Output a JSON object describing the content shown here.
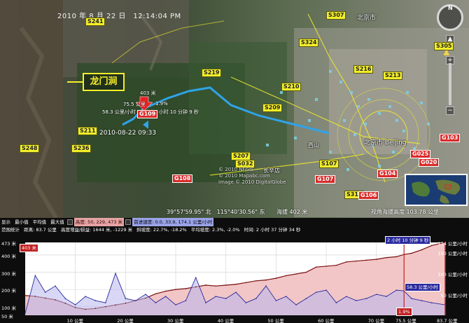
{
  "map": {
    "timestamp": "2010 年 8 月 22 日　12:14:04 PM",
    "place_label": "龙门涧",
    "start_datetime": "2010-08-22 09:33",
    "marker_elevation": "403 米",
    "marker_distance": "75.5 公里",
    "marker_speed": "58.3 公里/小时",
    "marker_grade": "1.9%",
    "marker_time": "2 小时 10 分钟 9 秒",
    "coordinates": "39°57'59.95\" 北　115°40'30.56\" 东",
    "altitude": "海拔 402 米",
    "eye_altitude": "视角海拔高度 103.78 公里",
    "copyright_lines": [
      "© 2010 NFGIS",
      "© 2010 Mapabc.com",
      "Image © 2010 DigitalGlobe"
    ],
    "cities": [
      {
        "name": "北京市"
      },
      {
        "name": "北京市 Beijing"
      },
      {
        "name": "长辛店"
      },
      {
        "name": "西山"
      }
    ],
    "road_shields": [
      "S307",
      "S241",
      "S324",
      "S305",
      "S216",
      "S219",
      "S210",
      "S213",
      "S209",
      "S211",
      "S248",
      "S236",
      "S207",
      "S032",
      "S315",
      "S107"
    ],
    "national_routes": [
      "G109",
      "G108",
      "G107",
      "G104",
      "G106",
      "G025",
      "G020",
      "G103"
    ],
    "compass_label": "N"
  },
  "panel": {
    "row1": {
      "label": "显示",
      "min_label": "最小值",
      "avg_label": "平均值",
      "max_label": "最大值",
      "elevation": "高度: 50, 229, 473 米",
      "speed": "前进速度: 0.0, 33.9, 174.1 公里/小时"
    },
    "row2": {
      "label": "范围统计",
      "distance": "距离: 83.7 公里",
      "gain": "高度增益/损益: 1644 米, -1229 米",
      "slope": "斜坡度: 22.7%, -18.2%",
      "avg_slope": "平均坡度: 2.3%, -2.0%",
      "time": "时间: 2 小时 37 分钟 34 秒"
    }
  },
  "chart_data": {
    "type": "area",
    "xlabel": "",
    "x_ticks": [
      "10 公里",
      "20 公里",
      "30 公里",
      "40 公里",
      "50 公里",
      "60 公里",
      "70 公里",
      "75.5 公里",
      "83.7 公里"
    ],
    "y_left_ticks": [
      "473 米",
      "400 米",
      "300 米",
      "200 米",
      "100 米",
      "50 米"
    ],
    "y_right_ticks": [
      "174 公里/小时",
      "150 公里/小时",
      "100 公里/小时",
      "50 公里/小时"
    ],
    "xlim": [
      0,
      83.7
    ],
    "ylim_elevation": [
      50,
      473
    ],
    "ylim_speed": [
      0,
      174
    ],
    "series": [
      {
        "name": "高度",
        "unit": "米",
        "color": "#7a0f0f",
        "x": [
          0,
          2,
          4,
          6,
          8,
          10,
          12,
          14,
          16,
          18,
          20,
          22,
          24,
          26,
          28,
          30,
          32,
          34,
          36,
          38,
          40,
          42,
          44,
          46,
          48,
          50,
          52,
          54,
          56,
          58,
          60,
          62,
          64,
          66,
          68,
          70,
          72,
          74,
          75.5,
          77,
          79,
          81,
          83.7
        ],
        "values": [
          165,
          160,
          150,
          140,
          120,
          95,
          85,
          90,
          100,
          110,
          120,
          135,
          150,
          175,
          190,
          200,
          205,
          215,
          225,
          220,
          225,
          230,
          240,
          250,
          255,
          265,
          280,
          290,
          300,
          330,
          335,
          340,
          360,
          365,
          370,
          375,
          385,
          390,
          403,
          410,
          430,
          455,
          473
        ]
      },
      {
        "name": "前进速度",
        "unit": "公里/小时",
        "color": "#2a2a9e",
        "x": [
          0,
          2,
          4,
          6,
          8,
          10,
          12,
          14,
          16,
          18,
          20,
          22,
          24,
          26,
          28,
          30,
          32,
          34,
          36,
          38,
          40,
          42,
          44,
          46,
          48,
          50,
          52,
          54,
          56,
          58,
          60,
          62,
          64,
          66,
          68,
          70,
          72,
          74,
          75.5,
          77,
          79,
          81,
          83.7
        ],
        "values": [
          5,
          95,
          55,
          70,
          40,
          25,
          45,
          35,
          30,
          100,
          40,
          35,
          50,
          30,
          45,
          25,
          35,
          90,
          30,
          45,
          40,
          55,
          30,
          40,
          70,
          35,
          45,
          25,
          40,
          55,
          60,
          30,
          45,
          35,
          40,
          50,
          45,
          60,
          58.3,
          40,
          35,
          30,
          25
        ]
      }
    ],
    "markers": [
      {
        "x": 75.5,
        "label_elevation": "403 米",
        "label_speed": "58.3 公里/小时",
        "label_grade": "1.9%",
        "label_time": "2 小时 10 分钟 9 秒"
      }
    ],
    "grid": true,
    "legend": "none"
  },
  "colors": {
    "elevation_fill": "#f2c6c6",
    "speed_fill": "#b8b8ee",
    "road_yellow": "#f4ef2a",
    "route_red": "#d92b2b",
    "track_blue": "#2fa3e8"
  }
}
